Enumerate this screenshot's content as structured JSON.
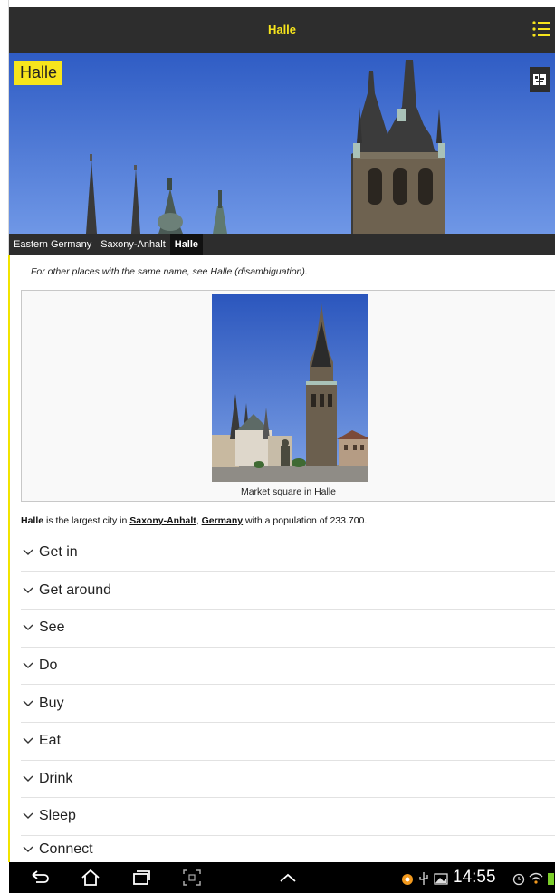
{
  "appbar": {
    "title": "Halle"
  },
  "hero": {
    "title": "Halle"
  },
  "breadcrumb": [
    "Eastern Germany",
    "Saxony-Anhalt",
    "Halle"
  ],
  "disambiguation": "For other places with the same name, see Halle (disambiguation).",
  "figure": {
    "caption": "Market square in Halle"
  },
  "lead": {
    "subject": "Halle",
    "text1": " is the largest city in ",
    "link1": "Saxony-Anhalt",
    "sep": ", ",
    "link2": "Germany",
    "text2": " with a population of 233.700."
  },
  "sections": [
    "Get in",
    "Get around",
    "See",
    "Do",
    "Buy",
    "Eat",
    "Drink",
    "Sleep",
    "Connect"
  ],
  "statusbar": {
    "time": "14:55"
  },
  "colors": {
    "accent": "#f7e51c",
    "bar": "#2d2d2d",
    "sky": "#3a66c8"
  }
}
